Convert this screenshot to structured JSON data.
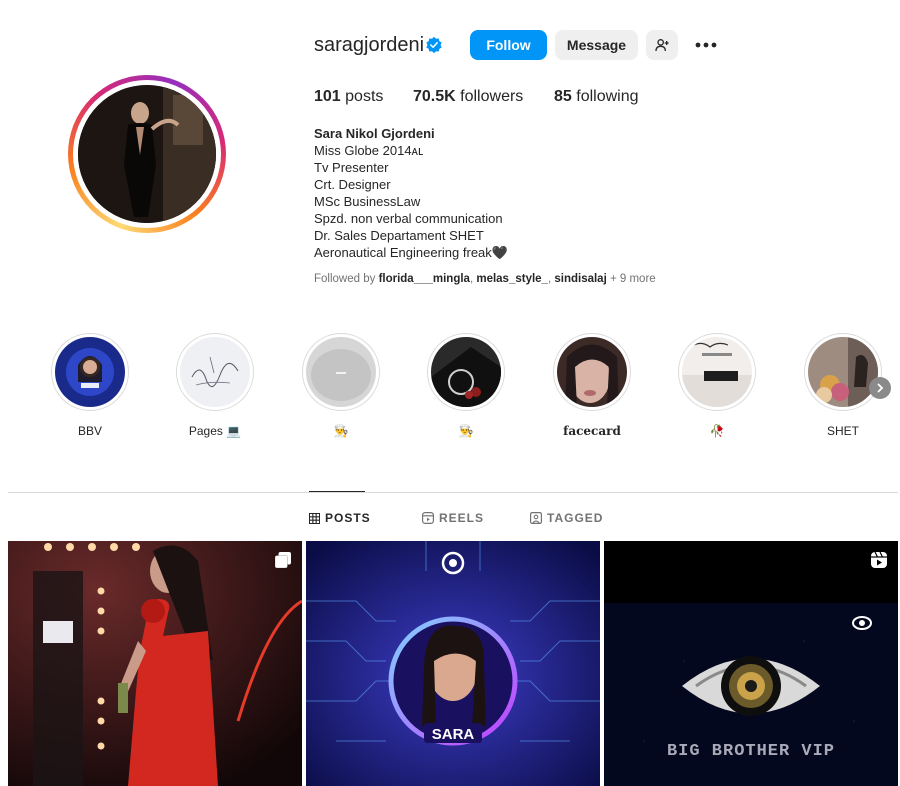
{
  "profile": {
    "username": "saragjordeni",
    "verified": true,
    "buttons": {
      "follow": "Follow",
      "message": "Message"
    },
    "stats": [
      {
        "value": "101",
        "label": "posts"
      },
      {
        "value": "70.5K",
        "label": "followers"
      },
      {
        "value": "85",
        "label": "following"
      }
    ],
    "bio": {
      "name": "Sara Nikol Gjordeni",
      "lines": [
        "Miss Globe 2014ᴀʟ",
        "Tv Presenter",
        "Crt. Designer",
        "MSc BusinessLaw",
        "Spzd. non verbal communication",
        "Dr. Sales Departament SHET",
        "Aeronautical Engineering freak🖤"
      ]
    },
    "followed_by": {
      "prefix": "Followed by ",
      "users": [
        "florida___mingla",
        "melas_style_",
        "sindisalaj"
      ],
      "suffix": " + 9 more"
    }
  },
  "highlights": [
    {
      "label": "BBV"
    },
    {
      "label": "Pages 💻"
    },
    {
      "label": "👨‍🍳"
    },
    {
      "label": "👨‍🍳"
    },
    {
      "label": "facecard"
    },
    {
      "label": "🥀"
    },
    {
      "label": "SHET"
    }
  ],
  "tabs": [
    {
      "label": "POSTS",
      "icon": "grid-icon",
      "active": true
    },
    {
      "label": "REELS",
      "icon": "reels-icon",
      "active": false
    },
    {
      "label": "TAGGED",
      "icon": "tagged-icon",
      "active": false
    }
  ],
  "posts": [
    {
      "type": "carousel",
      "icon": "carousel-icon"
    },
    {
      "type": "image",
      "caption": "SARA"
    },
    {
      "type": "reel",
      "icon": "reels-icon",
      "caption": "BIG BROTHER VIP"
    }
  ],
  "colors": {
    "accent": "#0095f6",
    "verified": "#0095f6",
    "text": "#262626",
    "muted": "#737373"
  }
}
